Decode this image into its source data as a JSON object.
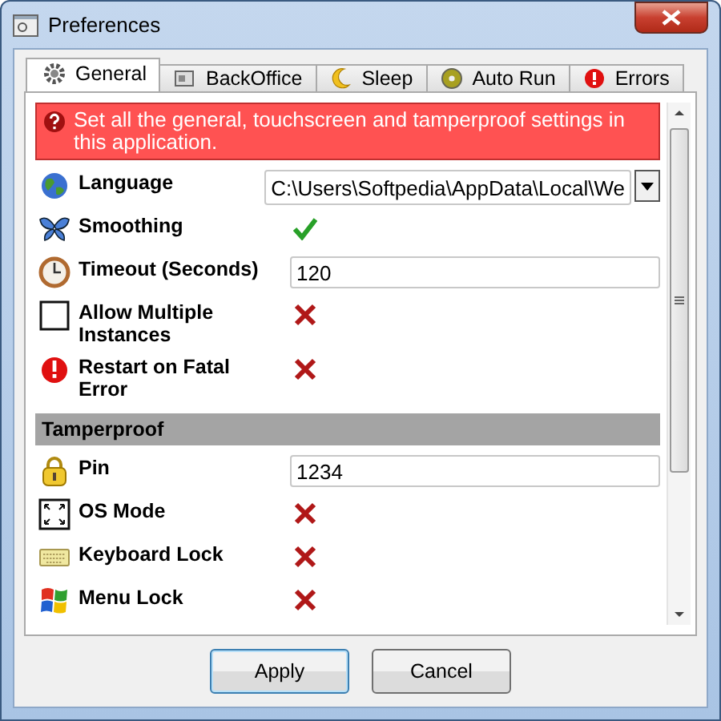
{
  "window": {
    "title": "Preferences"
  },
  "tabs": [
    {
      "label": "General",
      "selected": true
    },
    {
      "label": "BackOffice",
      "selected": false
    },
    {
      "label": "Sleep",
      "selected": false
    },
    {
      "label": "Auto Run",
      "selected": false
    },
    {
      "label": "Errors",
      "selected": false
    }
  ],
  "banner": {
    "text": "Set all the general, touchscreen and tamperproof settings in this application."
  },
  "items": [
    {
      "kind": "dropdown",
      "label": "Language",
      "value": "C:\\Users\\Softpedia\\AppData\\Local\\We"
    },
    {
      "kind": "toggle",
      "label": "Smoothing",
      "checked": true
    },
    {
      "kind": "text",
      "label": "Timeout (Seconds)",
      "value": "120"
    },
    {
      "kind": "toggle",
      "label": "Allow Multiple Instances",
      "checked": false
    },
    {
      "kind": "toggle",
      "label": "Restart on Fatal Error",
      "checked": false
    },
    {
      "kind": "header",
      "label": "Tamperproof"
    },
    {
      "kind": "text",
      "label": "Pin",
      "value": "1234"
    },
    {
      "kind": "toggle",
      "label": "OS Mode",
      "checked": false
    },
    {
      "kind": "toggle",
      "label": "Keyboard Lock",
      "checked": false
    },
    {
      "kind": "toggle",
      "label": "Menu Lock",
      "checked": false
    }
  ],
  "buttons": [
    {
      "label": "Apply",
      "focused": true
    },
    {
      "label": "Cancel",
      "focused": false
    }
  ]
}
